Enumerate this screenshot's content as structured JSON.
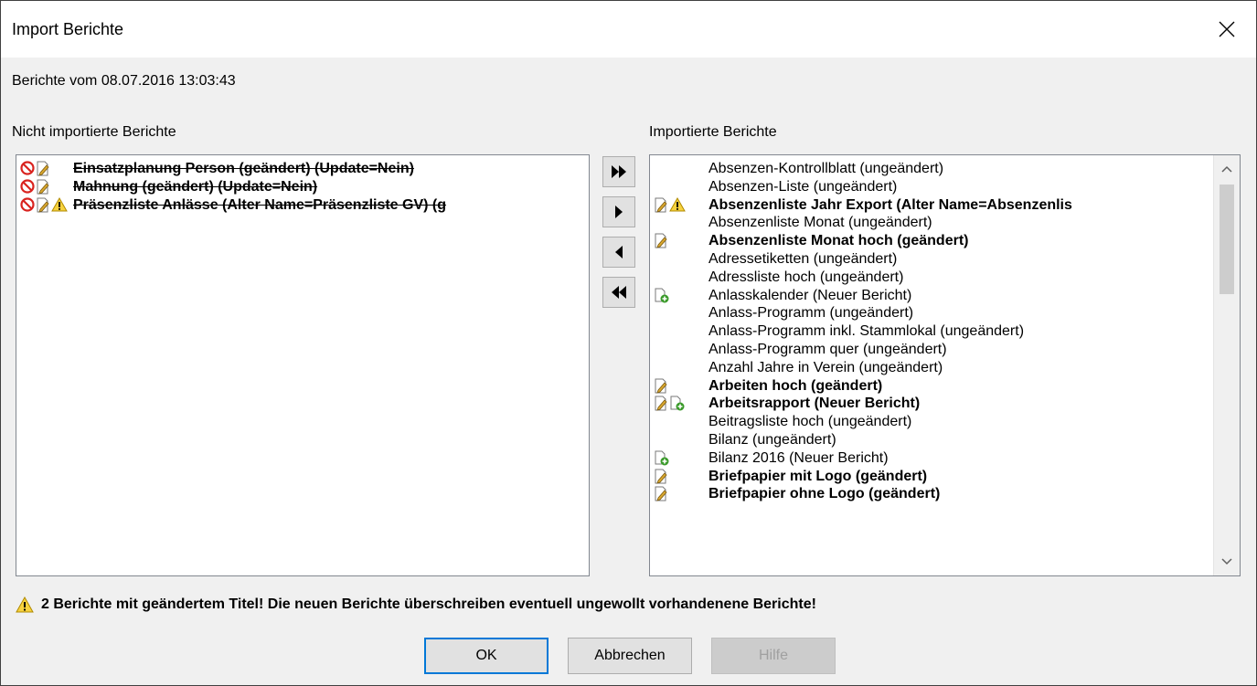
{
  "dialog": {
    "title": "Import Berichte",
    "date_label": "Berichte vom 08.07.2016 13:03:43",
    "left_label": "Nicht importierte Berichte",
    "right_label": "Importierte Berichte"
  },
  "not_imported": [
    {
      "text": "Einsatzplanung Person (geändert) (Update=Nein)",
      "icons": [
        "no-entry-icon",
        "edit-icon"
      ]
    },
    {
      "text": "Mahnung (geändert) (Update=Nein)",
      "icons": [
        "no-entry-icon",
        "edit-icon"
      ]
    },
    {
      "text": "Präsenzliste Anlässe (Alter Name=Präsenzliste GV) (g",
      "icons": [
        "no-entry-icon",
        "edit-icon",
        "warning-icon"
      ]
    }
  ],
  "imported": [
    {
      "text": "Absenzen-Kontrollblatt (ungeändert)",
      "bold": false,
      "icons": []
    },
    {
      "text": "Absenzen-Liste (ungeändert)",
      "bold": false,
      "icons": []
    },
    {
      "text": "Absenzenliste Jahr Export (Alter Name=Absenzenlis",
      "bold": true,
      "icons": [
        "edit-icon",
        "warning-icon"
      ]
    },
    {
      "text": "Absenzenliste Monat (ungeändert)",
      "bold": false,
      "icons": []
    },
    {
      "text": "Absenzenliste Monat hoch (geändert)",
      "bold": true,
      "icons": [
        "edit-icon"
      ]
    },
    {
      "text": "Adressetiketten (ungeändert)",
      "bold": false,
      "icons": []
    },
    {
      "text": "Adressliste hoch (ungeändert)",
      "bold": false,
      "icons": []
    },
    {
      "text": "Anlasskalender (Neuer Bericht)",
      "bold": false,
      "icons": [
        "new-doc-icon"
      ]
    },
    {
      "text": "Anlass-Programm (ungeändert)",
      "bold": false,
      "icons": []
    },
    {
      "text": "Anlass-Programm inkl. Stammlokal (ungeändert)",
      "bold": false,
      "icons": []
    },
    {
      "text": "Anlass-Programm quer (ungeändert)",
      "bold": false,
      "icons": []
    },
    {
      "text": "Anzahl Jahre in Verein (ungeändert)",
      "bold": false,
      "icons": []
    },
    {
      "text": "Arbeiten hoch (geändert)",
      "bold": true,
      "icons": [
        "edit-icon"
      ]
    },
    {
      "text": "Arbeitsrapport (Neuer Bericht)",
      "bold": true,
      "icons": [
        "edit-icon",
        "new-doc-icon"
      ]
    },
    {
      "text": "Beitragsliste hoch (ungeändert)",
      "bold": false,
      "icons": []
    },
    {
      "text": "Bilanz (ungeändert)",
      "bold": false,
      "icons": []
    },
    {
      "text": "Bilanz 2016 (Neuer Bericht)",
      "bold": false,
      "icons": [
        "new-doc-icon"
      ]
    },
    {
      "text": "Briefpapier mit Logo (geändert)",
      "bold": true,
      "icons": [
        "edit-icon"
      ]
    },
    {
      "text": "Briefpapier ohne Logo (geändert)",
      "bold": true,
      "icons": [
        "edit-icon"
      ]
    }
  ],
  "warning": "2 Berichte mit geändertem Titel!  Die neuen Berichte überschreiben eventuell ungewollt vorhandenene Berichte!",
  "buttons": {
    "ok": "OK",
    "cancel": "Abbrechen",
    "help": "Hilfe"
  }
}
